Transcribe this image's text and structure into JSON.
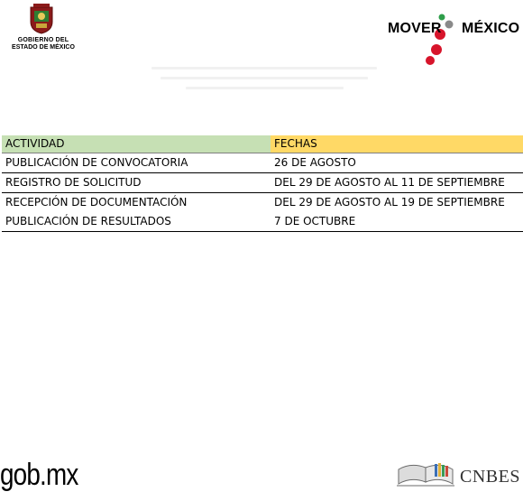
{
  "header": {
    "gov_logo": {
      "line1": "GOBIERNO DEL",
      "line2": "ESTADO DE MÉXICO",
      "icon": "coat-of-arms-icon"
    },
    "mover_logo": {
      "word1": "MOVER",
      "word2": "MÉXICO",
      "icon": "mover-dots-icon",
      "colors": {
        "green": "#2e9e4a",
        "red": "#d7142b",
        "gray": "#8a8a8a"
      }
    }
  },
  "schedule": {
    "headers": {
      "activity": "ACTIVIDAD",
      "dates": "FECHAS"
    },
    "header_colors": {
      "activity": "#c6e0b4",
      "dates": "#ffd966"
    },
    "rows": [
      {
        "activity": "PUBLICACIÓN DE CONVOCATORIA",
        "dates": "26 DE AGOSTO"
      },
      {
        "activity": "REGISTRO DE SOLICITUD",
        "dates": "DEL 29 DE AGOSTO AL 11 DE SEPTIEMBRE"
      },
      {
        "activity": "RECEPCIÓN DE DOCUMENTACIÓN",
        "dates": "DEL 29 DE AGOSTO AL 19 DE SEPTIEMBRE"
      },
      {
        "activity": "PUBLICACIÓN DE RESULTADOS",
        "dates": "7 DE OCTUBRE"
      }
    ]
  },
  "footer": {
    "gobmx": "gob.mx",
    "cnbes": {
      "word": "CNBES",
      "icon": "open-book-icon"
    }
  }
}
